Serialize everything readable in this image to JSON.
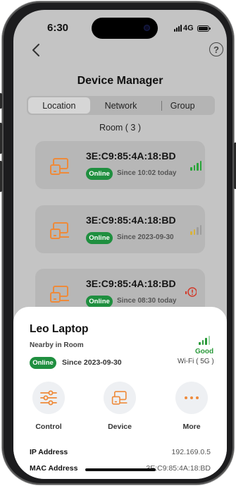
{
  "status_bar": {
    "time": "6:30",
    "network": "4G"
  },
  "header": {
    "title": "Device Manager",
    "help_label": "?"
  },
  "tabs": [
    {
      "label": "Location",
      "active": true
    },
    {
      "label": "Network",
      "active": false
    },
    {
      "label": "Group",
      "active": false
    }
  ],
  "room_label": "Room ( 3 )",
  "devices": [
    {
      "mac": "3E:C9:85:4A:18:BD",
      "status": "Online",
      "since": "Since 10:02 today",
      "signal": "strong",
      "signal_color": "#2aa53a",
      "icon": "laptop-icon"
    },
    {
      "mac": "3E:C9:85:4A:18:BD",
      "status": "Online",
      "since": "Since 2023-09-30",
      "signal": "medium",
      "signal_color": "#d8b23a",
      "icon": "laptop-icon"
    },
    {
      "mac": "3E:C9:85:4A:18:BD",
      "status": "Online",
      "since": "Since 08:30 today",
      "signal": "alert",
      "signal_color": "#d23a2a",
      "icon": "laptop-icon"
    }
  ],
  "detail": {
    "name": "Leo Laptop",
    "location": "Nearby in Room",
    "status": "Online",
    "since": "Since 2023-09-30",
    "signal_quality": "Good",
    "connection": "Wi-Fi ( 5G )",
    "actions": [
      {
        "label": "Control",
        "icon": "sliders-icon"
      },
      {
        "label": "Device",
        "icon": "laptop-icon"
      },
      {
        "label": "More",
        "icon": "more-dots-icon"
      }
    ],
    "info": [
      {
        "key": "IP Address",
        "value": "192.169.0.5"
      },
      {
        "key": "MAC Address",
        "value": "3E:C9:85:4A:18:BD"
      }
    ]
  },
  "colors": {
    "accent": "#ee8a3a",
    "online_badge": "#1f8f3f",
    "good": "#2a9a3a"
  }
}
